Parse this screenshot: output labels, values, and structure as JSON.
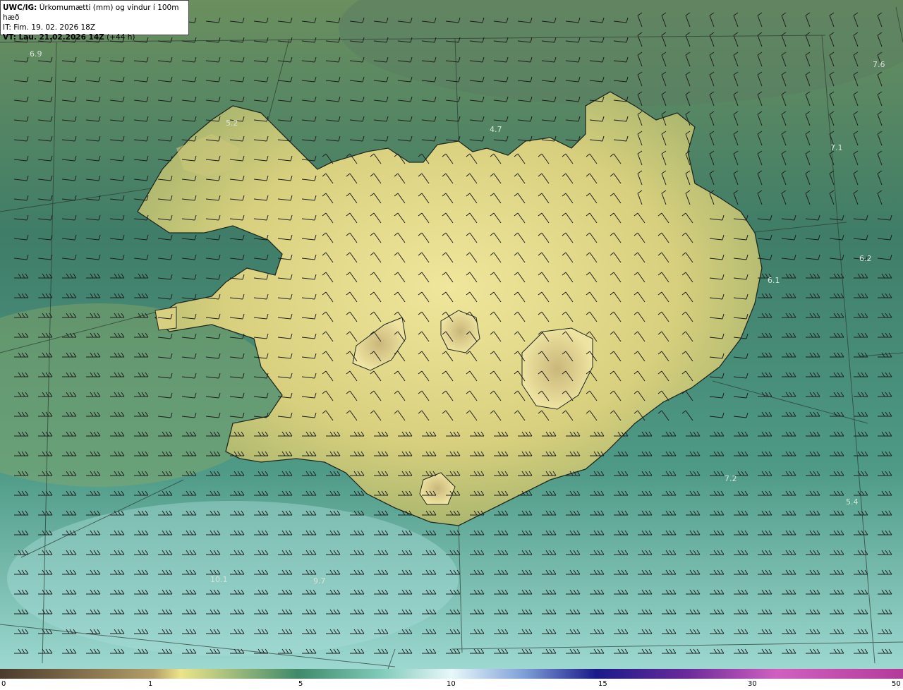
{
  "header": {
    "model": "UWC/IG:",
    "title": "Úrkomumætti (mm) og vindur í 100m hæð",
    "initial_time": "IT: Fim. 19. 02. 2026 18Z",
    "valid_label": "VT: Lau. 21.02.2026 14Z",
    "valid_offset": "(+44 h)"
  },
  "point_values": [
    "6.9",
    "5.2",
    "4.7",
    "7.6",
    "7.1",
    "6.2",
    "6.1",
    "7.2",
    "5.4",
    "10.1",
    "9.7"
  ],
  "colorbar": {
    "labels": [
      "0",
      "1",
      "5",
      "10",
      "15",
      "30",
      "50"
    ],
    "colors": [
      "#5a4a3a",
      "#a8935f",
      "#ece48a",
      "#3f8a6a",
      "#7fc9b8",
      "#dff3f8",
      "#7fa0d8",
      "#1a1a8a",
      "#6a2a9a",
      "#d060c0",
      "#f0b0e0"
    ]
  },
  "map_colors": {
    "sea_far": "#5c8a68",
    "sea_near": "#3f7f6c",
    "sea_south": "#7cc2b8",
    "land_low": "#d8cf7c",
    "land_high": "#efe59a",
    "coast": "#1e2a22"
  }
}
